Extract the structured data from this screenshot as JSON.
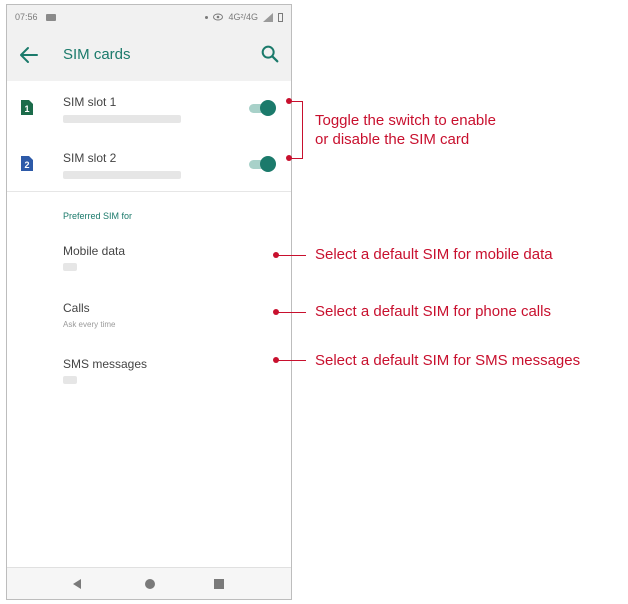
{
  "status_bar": {
    "time": "07:56",
    "network": "4G²/4G"
  },
  "app_bar": {
    "title": "SIM cards"
  },
  "sim_slots": [
    {
      "label": "SIM slot 1",
      "number": "1",
      "enabled": true
    },
    {
      "label": "SIM slot 2",
      "number": "2",
      "enabled": true
    }
  ],
  "preferred": {
    "header": "Preferred SIM for",
    "items": [
      {
        "label": "Mobile data",
        "sub": ""
      },
      {
        "label": "Calls",
        "sub": "Ask every time"
      },
      {
        "label": "SMS messages",
        "sub": ""
      }
    ]
  },
  "annotations": {
    "toggle": "Toggle the switch to enable\nor disable the SIM card",
    "mobile_data": "Select a default SIM for mobile data",
    "calls": "Select a default SIM for phone calls",
    "sms": "Select a default SIM for SMS messages"
  },
  "colors": {
    "accent": "#1b7a6b",
    "sim1_icon": "#1b6b4a",
    "sim2_icon": "#2d5aa8",
    "annotation": "#c8102e"
  },
  "icons": [
    "back-arrow-icon",
    "search-icon",
    "sim-card-icon",
    "nav-back-icon",
    "nav-home-icon",
    "nav-recents-icon"
  ]
}
